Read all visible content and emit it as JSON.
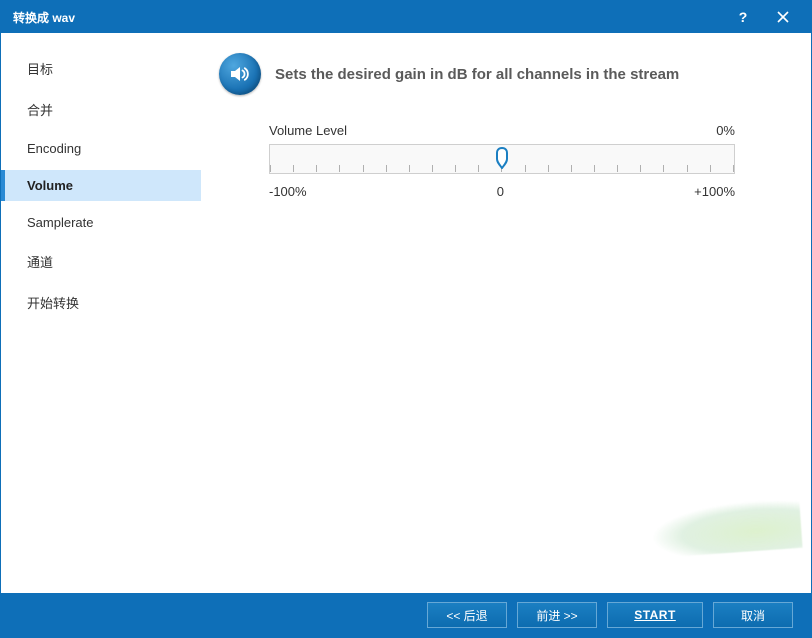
{
  "window": {
    "title": "转换成 wav"
  },
  "sidebar": {
    "items": [
      {
        "label": "目标"
      },
      {
        "label": "合并"
      },
      {
        "label": "Encoding"
      },
      {
        "label": "Volume"
      },
      {
        "label": "Samplerate"
      },
      {
        "label": "通道"
      },
      {
        "label": "开始转换"
      }
    ],
    "selected_index": 3
  },
  "page": {
    "heading": "Sets the desired gain in dB for all channels in the stream",
    "volume_label": "Volume Level",
    "volume_value": "0%",
    "range_min": "-100%",
    "range_mid": "0",
    "range_max": "+100%",
    "slider_position_pct": 50
  },
  "footer": {
    "back": "<< 后退",
    "next": "前进 >>",
    "start": "START",
    "cancel": "取消"
  }
}
